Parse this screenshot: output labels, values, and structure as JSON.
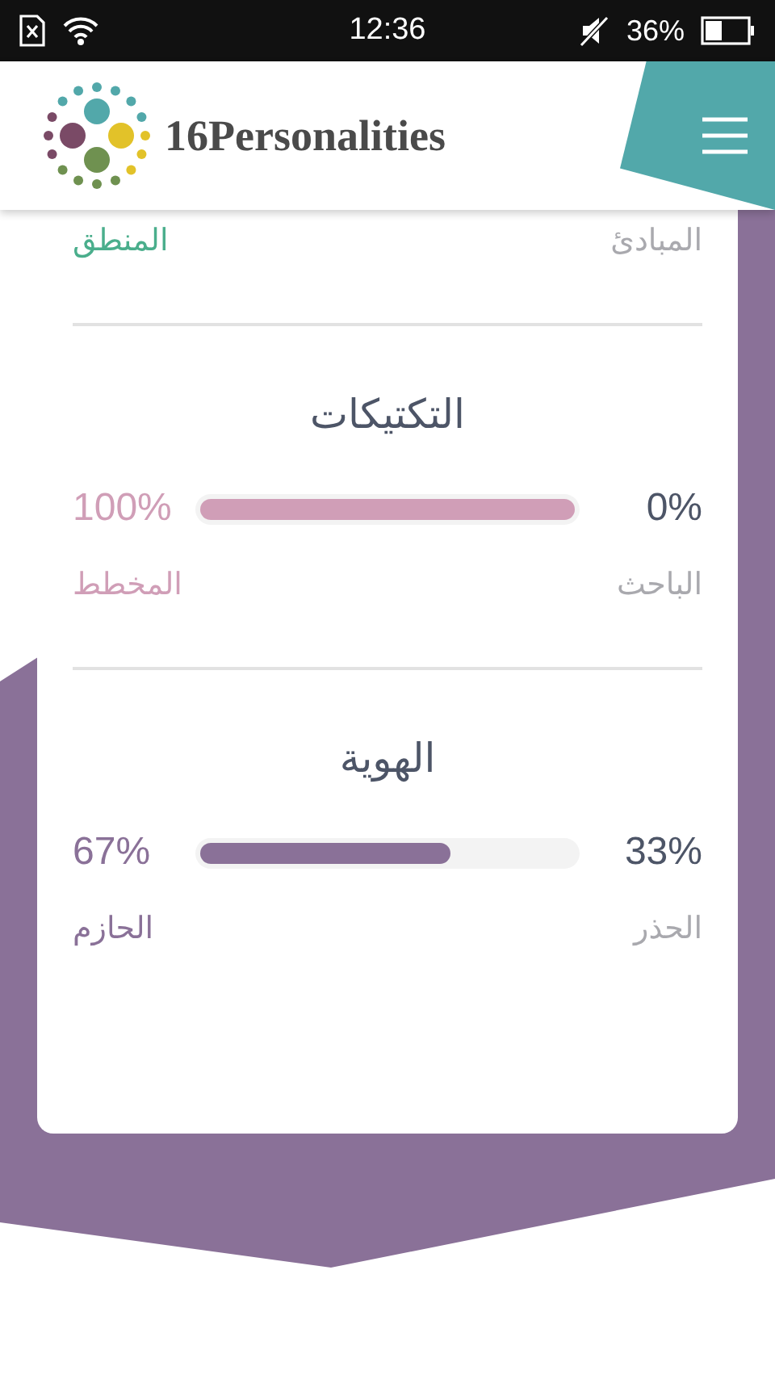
{
  "status_bar": {
    "time": "12:36",
    "battery": "36%"
  },
  "header": {
    "logo": "16Personalities"
  },
  "partial_section": {
    "left_label": "المنطق",
    "right_label": "المبادئ",
    "color": "#4aae8c"
  },
  "sections": [
    {
      "title": "التكتيكات",
      "left_percent": "100%",
      "right_percent": "0%",
      "level": 1,
      "left_label": "المخطط",
      "right_label": "الباحث",
      "color": "#d09eb7"
    },
    {
      "title": "الهوية",
      "left_percent": "67%",
      "right_percent": "33%",
      "level": 0.67,
      "left_label": "الحازم",
      "right_label": "الحذر",
      "color": "#8a7198"
    }
  ]
}
